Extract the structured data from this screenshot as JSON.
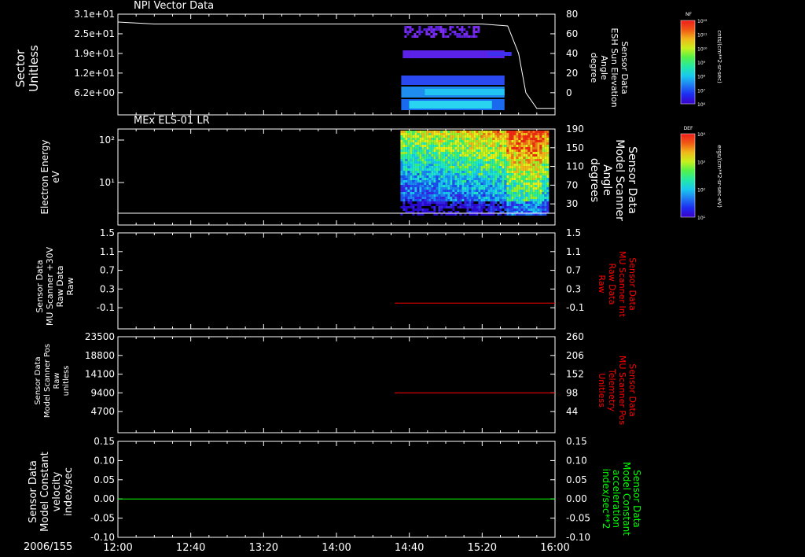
{
  "panel1": {
    "title": "NPI Vector Data",
    "ylabel": "Sector\nUnitless",
    "yticks": [
      "3.1e+01",
      "2.5e+01",
      "1.9e+01",
      "1.2e+01",
      "6.2e+00"
    ],
    "rlabel": "Sensor Data\nESH Sun Elevation\nAngle\ndegree",
    "rticks": [
      "80",
      "60",
      "40",
      "20",
      "0"
    ],
    "cbar_title": "NF",
    "cbar_label": "cnts/(cm**2-sr-sec)",
    "cbar_ticks": [
      "10¹²",
      "10¹¹",
      "10¹⁰",
      "10⁹",
      "10⁸",
      "10⁷",
      "10⁶"
    ]
  },
  "panel2": {
    "title": "MEx ELS-01 LR",
    "ylabel": "Electron Energy\neV",
    "yticks": [
      "10²",
      "10¹"
    ],
    "rlabel": "Sensor Data\nModel Scanner\nAngle\ndegrees",
    "rticks": [
      "190",
      "150",
      "110",
      "70",
      "30"
    ],
    "cbar_title": "DEF",
    "cbar_label": "ergs/(cm**2-sr-sec-eV)",
    "cbar_ticks": [
      "10⁴",
      "10³",
      "10²",
      "10¹"
    ]
  },
  "panel3": {
    "ylabel": "Sensor Data\nMU Scanner +30V\nRaw Data\nRaw",
    "yticks": [
      "1.5",
      "1.1",
      "0.7",
      "0.3",
      "-0.1"
    ],
    "rlabel": "Sensor Data\nMU Scanner Int\nRaw Data\nRaw",
    "rticks": [
      "1.5",
      "1.1",
      "0.7",
      "0.3",
      "-0.1"
    ]
  },
  "panel4": {
    "ylabel": "Sensor Data\nModel Scanner Pos\nRaw\nunitless",
    "yticks": [
      "23500",
      "18800",
      "14100",
      "9400",
      "4700"
    ],
    "rlabel": "Sensor Data\nMU Scanner Pos\nTelemetry\nUnitless",
    "rticks": [
      "260",
      "206",
      "152",
      "98",
      "44"
    ]
  },
  "panel5": {
    "ylabel": "Sensor Data\nModel Constant\nvelocity\nindex/sec",
    "yticks": [
      "0.15",
      "0.10",
      "0.05",
      "0.00",
      "-0.05",
      "-0.10"
    ],
    "rlabel": "Sensor Data\nModel Constant\nacceleration\nindex/sec**2",
    "rticks": [
      "0.15",
      "0.10",
      "0.05",
      "0.00",
      "-0.05",
      "-0.10"
    ]
  },
  "xaxis": {
    "date": "2006/155",
    "ticks": [
      "12:00",
      "12:40",
      "13:20",
      "14:00",
      "14:40",
      "15:20",
      "16:00"
    ]
  },
  "colors": {
    "axis": "#ffffff",
    "red_trace": "#ff0000",
    "green_trace": "#00ff00",
    "white_trace": "#ffffff"
  },
  "chart_data": [
    {
      "type": "heatmap",
      "title": "NPI Vector Data",
      "xlabel": "",
      "ylabel": "Sector Unitless",
      "x_range": [
        "12:00",
        "16:00"
      ],
      "data_interval": [
        "14:36",
        "15:34"
      ],
      "overlay_line": {
        "name": "Sensor Data ESH Sun Elevation Angle",
        "x": [
          "12:00",
          "12:20",
          "13:00",
          "14:00",
          "14:40",
          "15:20",
          "15:34",
          "15:40",
          "15:44",
          "15:50",
          "16:00"
        ],
        "y": [
          72,
          70,
          70,
          70,
          70,
          70,
          68,
          40,
          0,
          -16,
          -16
        ]
      }
    },
    {
      "type": "heatmap",
      "title": "MEx ELS-01 LR",
      "xlabel": "",
      "ylabel": "Electron Energy eV",
      "x_range": [
        "12:00",
        "16:00"
      ],
      "data_interval": [
        "14:36",
        "16:00"
      ],
      "overlay_line": {
        "name": "Sensor Data Model Scanner Angle",
        "x": [
          "12:00",
          "16:00"
        ],
        "y": [
          10,
          10
        ]
      }
    },
    {
      "type": "line",
      "series": [
        {
          "name": "Sensor Data MU Scanner Int Raw Data",
          "x": [
            "14:32",
            "16:00"
          ],
          "y": [
            0.0,
            0.0
          ]
        }
      ],
      "ylim": [
        -0.3,
        1.5
      ]
    },
    {
      "type": "line",
      "series": [
        {
          "name": "Sensor Data MU Scanner Pos Telemetry",
          "x": [
            "14:32",
            "16:00"
          ],
          "y": [
            98,
            98
          ]
        }
      ],
      "ylim": [
        0,
        260
      ]
    },
    {
      "type": "line",
      "series": [
        {
          "name": "Sensor Data Model Constant acceleration",
          "x": [
            "12:00",
            "16:00"
          ],
          "y": [
            0.0,
            0.0
          ]
        }
      ],
      "ylim": [
        -0.1,
        0.15
      ]
    }
  ]
}
